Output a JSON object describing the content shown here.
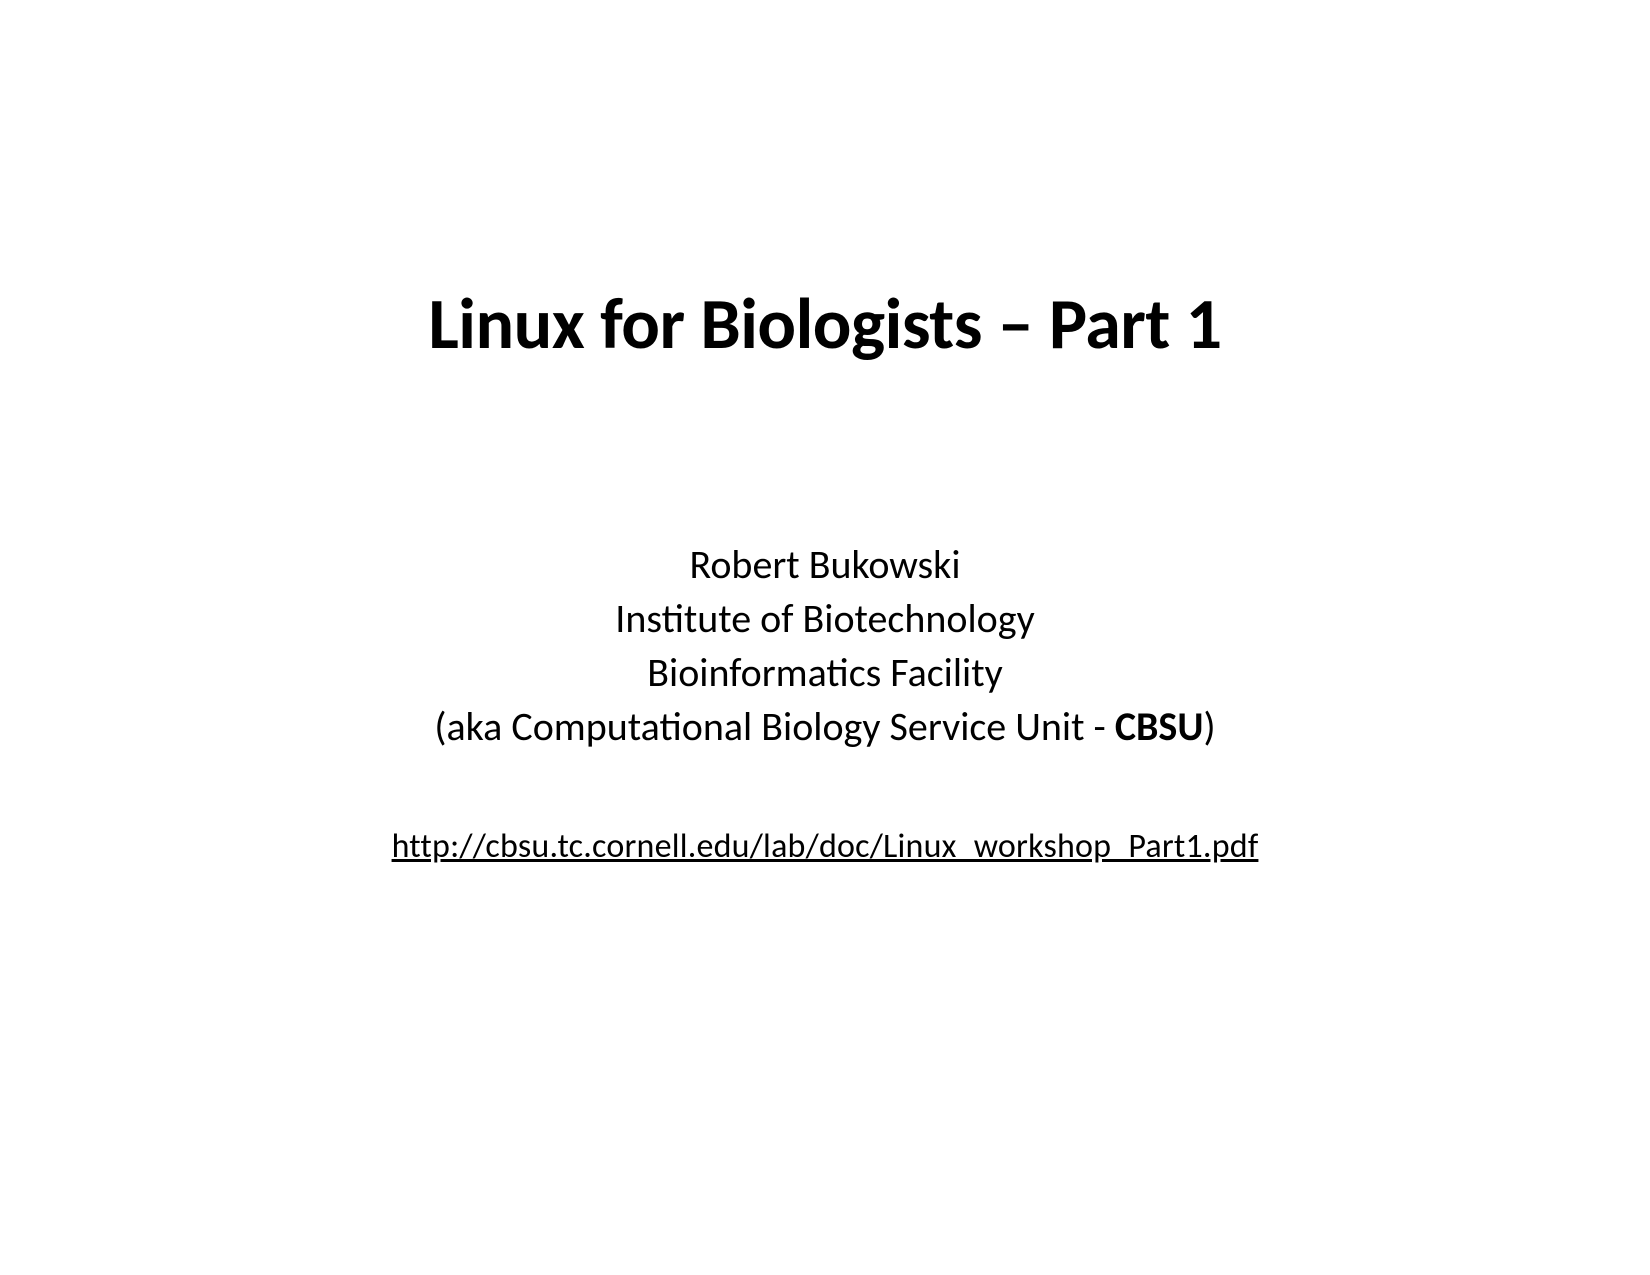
{
  "slide": {
    "title": "Linux for Biologists – Part 1",
    "author": "Robert Bukowski",
    "institute": "Institute of Biotechnology",
    "facility": "Bioinformatics Facility",
    "aka_prefix": "(aka Computational Biology Service Unit - ",
    "aka_bold": "CBSU",
    "aka_suffix": ")",
    "link": "http://cbsu.tc.cornell.edu/lab/doc/Linux_workshop_Part1.pdf"
  }
}
